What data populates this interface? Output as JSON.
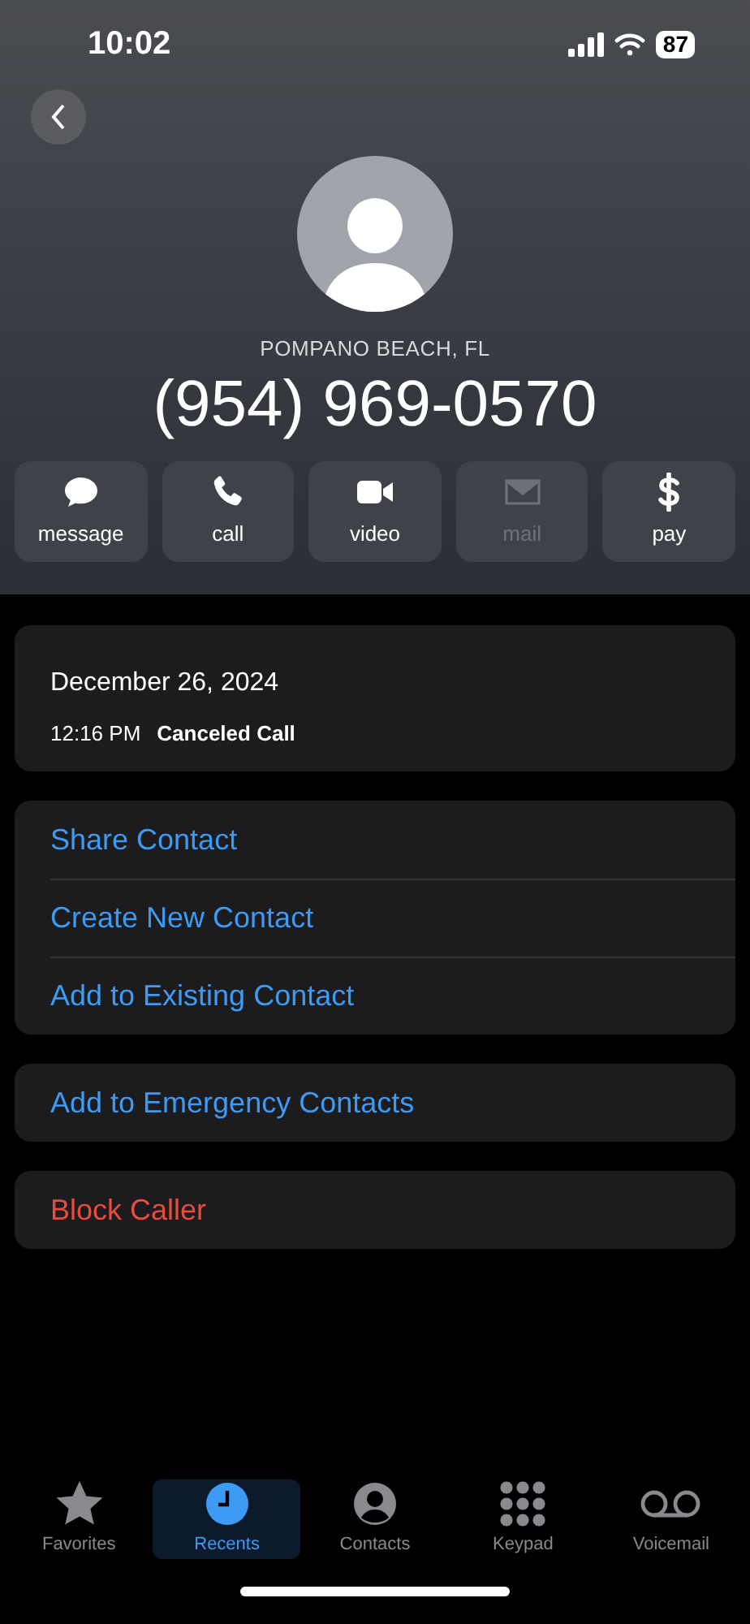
{
  "status_bar": {
    "time": "10:02",
    "battery": "87"
  },
  "contact": {
    "location": "POMPANO BEACH, FL",
    "phone": "(954) 969-0570"
  },
  "actions": [
    {
      "kind": "message",
      "label": "message",
      "disabled": false
    },
    {
      "kind": "call",
      "label": "call",
      "disabled": false
    },
    {
      "kind": "video",
      "label": "video",
      "disabled": false
    },
    {
      "kind": "mail",
      "label": "mail",
      "disabled": true
    },
    {
      "kind": "pay",
      "label": "pay",
      "disabled": false
    }
  ],
  "call_log": {
    "date": "December 26, 2024",
    "time": "12:16 PM",
    "status": "Canceled Call"
  },
  "groups": [
    [
      {
        "label": "Share Contact",
        "kind": "link"
      },
      {
        "label": "Create New Contact",
        "kind": "link"
      },
      {
        "label": "Add to Existing Contact",
        "kind": "link"
      }
    ],
    [
      {
        "label": "Add to Emergency Contacts",
        "kind": "link"
      }
    ],
    [
      {
        "label": "Block Caller",
        "kind": "destructive"
      }
    ]
  ],
  "tabs": [
    {
      "kind": "favorites",
      "label": "Favorites",
      "selected": false
    },
    {
      "kind": "recents",
      "label": "Recents",
      "selected": true
    },
    {
      "kind": "contacts",
      "label": "Contacts",
      "selected": false
    },
    {
      "kind": "keypad",
      "label": "Keypad",
      "selected": false
    },
    {
      "kind": "voicemail",
      "label": "Voicemail",
      "selected": false
    }
  ]
}
